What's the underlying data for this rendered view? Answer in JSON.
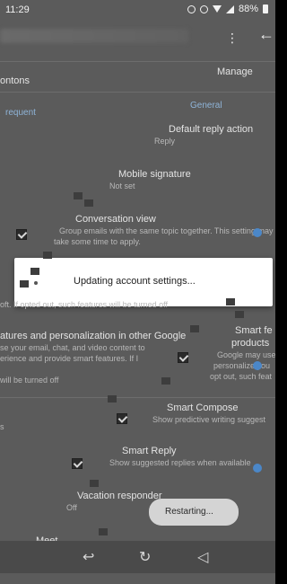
{
  "status_bar": {
    "time": "11:29",
    "battery": "88%"
  },
  "app_bar": {
    "more_icon": "more-vert-icon",
    "back_icon": "arrow-back-icon"
  },
  "rows": {
    "manage_label": "Manage",
    "nontons_label": "ontons",
    "frequent_label": "requent",
    "general_section": "General",
    "default_reply_title": "Default reply action",
    "default_reply_value": "Reply",
    "mobile_signature_title": "Mobile signature",
    "mobile_signature_value": "Not set",
    "conversation_view_title": "Conversation view",
    "conversation_view_sub": "Group emails with the same topic together. This setting may",
    "conversation_view_sub2": "take some time to apply.",
    "smart_features_sub": "oft. If opted out, such features will be turned off",
    "smart_features_title": "atures and personalization in other Google",
    "smart_features_sub2": "se your email, chat, and video content to",
    "smart_features_sub3": "erience and provide smart features. If I",
    "smart_features_sub4": "will be turned off",
    "shared_features_title": "Smart fe",
    "shared_products_title": "products",
    "shared_sub": "Google may use",
    "shared_sub2": "personalize you",
    "shared_sub3": "opt out, such feat",
    "smart_compose_title": "Smart Compose",
    "smart_compose_sub": "Show predictive writing suggest",
    "es_label": "s",
    "smart_reply_title": "Smart Reply",
    "smart_reply_sub": "Show suggested replies when available",
    "vacation_title": "Vacation responder",
    "vacation_value": "Off",
    "meet_label": "Meet"
  },
  "dialog": {
    "message": "Updating account settings..."
  },
  "toast": {
    "message": "Restarting..."
  },
  "nav_bar": {
    "back_icon": "nav-back-icon",
    "home_icon": "nav-home-icon",
    "recent_icon": "nav-recent-icon"
  }
}
